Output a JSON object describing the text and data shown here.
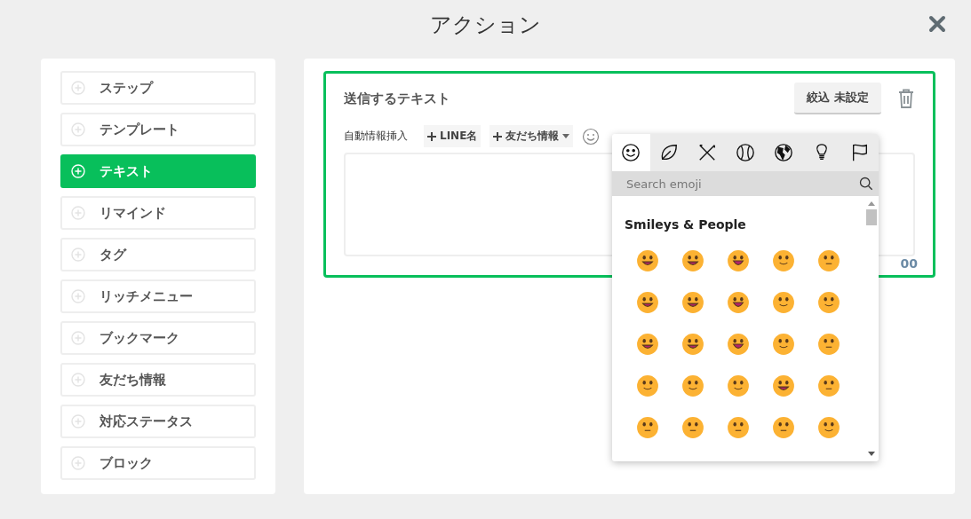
{
  "header": {
    "title": "アクション"
  },
  "sidebar": {
    "items": [
      {
        "label": "ステップ",
        "selected": false
      },
      {
        "label": "テンプレート",
        "selected": false
      },
      {
        "label": "テキスト",
        "selected": true
      },
      {
        "label": "リマインド",
        "selected": false
      },
      {
        "label": "タグ",
        "selected": false
      },
      {
        "label": "リッチメニュー",
        "selected": false
      },
      {
        "label": "ブックマーク",
        "selected": false
      },
      {
        "label": "友だち情報",
        "selected": false
      },
      {
        "label": "対応ステータス",
        "selected": false
      },
      {
        "label": "ブロック",
        "selected": false
      }
    ]
  },
  "editor": {
    "title": "送信するテキスト",
    "filter_button": "絞込 未設定",
    "insert_label": "自動情報挿入",
    "insert_buttons": [
      {
        "label": "LINE名",
        "dropdown": false
      },
      {
        "label": "友だち情報",
        "dropdown": true
      }
    ],
    "counter": "00"
  },
  "emoji_picker": {
    "categories": [
      {
        "kind": "smiley",
        "selected": true
      },
      {
        "kind": "leaf",
        "selected": false
      },
      {
        "kind": "cutlery",
        "selected": false
      },
      {
        "kind": "ball",
        "selected": false
      },
      {
        "kind": "globe",
        "selected": false
      },
      {
        "kind": "bulb",
        "selected": false
      },
      {
        "kind": "flag",
        "selected": false
      }
    ],
    "search": {
      "placeholder": "Search emoji"
    },
    "section_title": "Smileys & People",
    "emojis": [
      {
        "kind": "grin"
      },
      {
        "kind": "beam"
      },
      {
        "kind": "laugh"
      },
      {
        "kind": "smile"
      },
      {
        "kind": "neutral"
      },
      {
        "kind": "grin"
      },
      {
        "kind": "beam"
      },
      {
        "kind": "laugh"
      },
      {
        "kind": "smile"
      },
      {
        "kind": "smile"
      },
      {
        "kind": "grin"
      },
      {
        "kind": "beam"
      },
      {
        "kind": "laugh"
      },
      {
        "kind": "smile"
      },
      {
        "kind": "neutral"
      },
      {
        "kind": "smile"
      },
      {
        "kind": "smile"
      },
      {
        "kind": "smile"
      },
      {
        "kind": "grin"
      },
      {
        "kind": "neutral"
      },
      {
        "kind": "neutral"
      },
      {
        "kind": "neutral"
      },
      {
        "kind": "neutral"
      },
      {
        "kind": "neutral"
      },
      {
        "kind": "smile"
      }
    ]
  }
}
